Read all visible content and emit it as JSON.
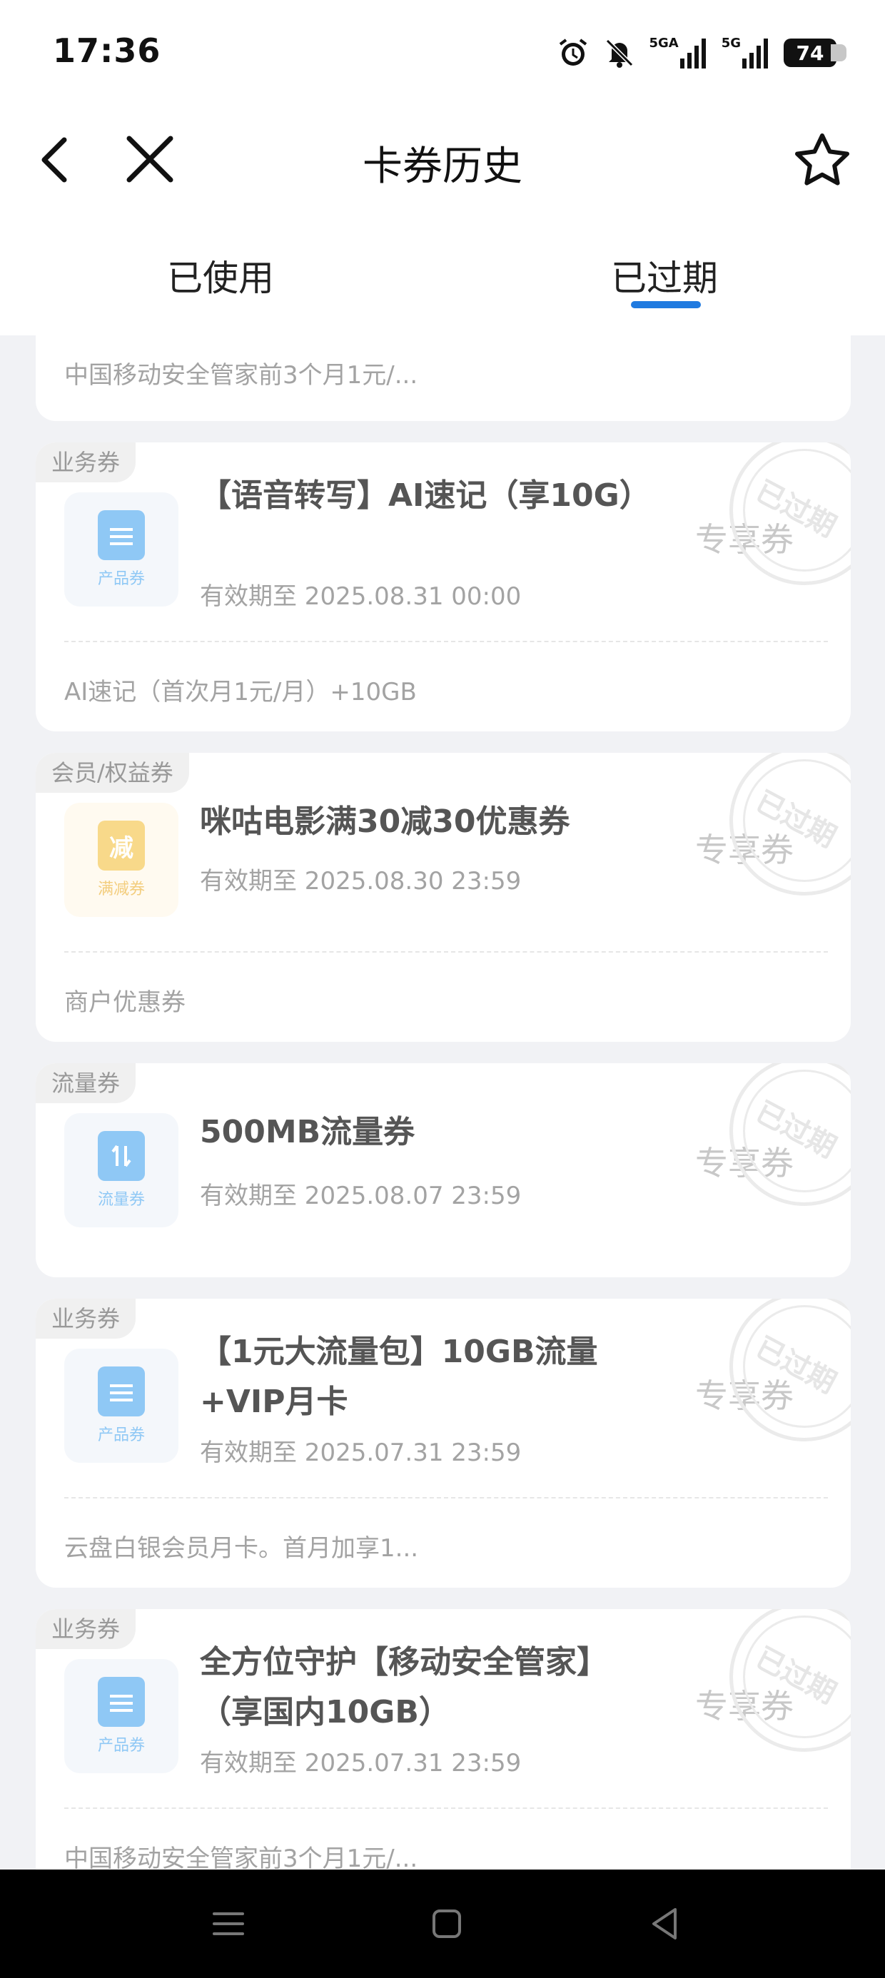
{
  "status": {
    "time": "17:36",
    "battery": "74",
    "net1": "5GA",
    "net2": "5G"
  },
  "nav": {
    "title": "卡券历史"
  },
  "tabs": [
    {
      "label": "已使用"
    },
    {
      "label": "已过期"
    }
  ],
  "active_tab": "已过期",
  "stamp_text": "已过期",
  "cards": [
    {
      "desc": "中国移动安全管家前3个月1元/..."
    },
    {
      "tag": "业务券",
      "icon_caption": "产品券",
      "title": "【语音转写】AI速记（享10G）",
      "expiry": "有效期至 2025.08.31 00:00",
      "badge": "专享券",
      "desc": "AI速记（首次月1元/月）+10GB"
    },
    {
      "tag": "会员/权益券",
      "icon_glyph": "减",
      "icon_caption": "满减券",
      "title": "咪咕电影满30减30优惠券",
      "expiry": "有效期至 2025.08.30 23:59",
      "badge": "专享券",
      "desc": "商户优惠券"
    },
    {
      "tag": "流量券",
      "icon_caption": "流量券",
      "title": "500MB流量券",
      "expiry": "有效期至 2025.08.07 23:59",
      "badge": "专享券"
    },
    {
      "tag": "业务券",
      "icon_caption": "产品券",
      "title": "【1元大流量包】10GB流量+VIP月卡",
      "expiry": "有效期至 2025.07.31 23:59",
      "badge": "专享券",
      "desc": "云盘白银会员月卡。首月加享1..."
    },
    {
      "tag": "业务券",
      "icon_caption": "产品券",
      "title": "全方位守护【移动安全管家】（享国内10GB）",
      "expiry": "有效期至 2025.07.31 23:59",
      "badge": "专享券",
      "desc": "中国移动安全管家前3个月1元/..."
    }
  ]
}
